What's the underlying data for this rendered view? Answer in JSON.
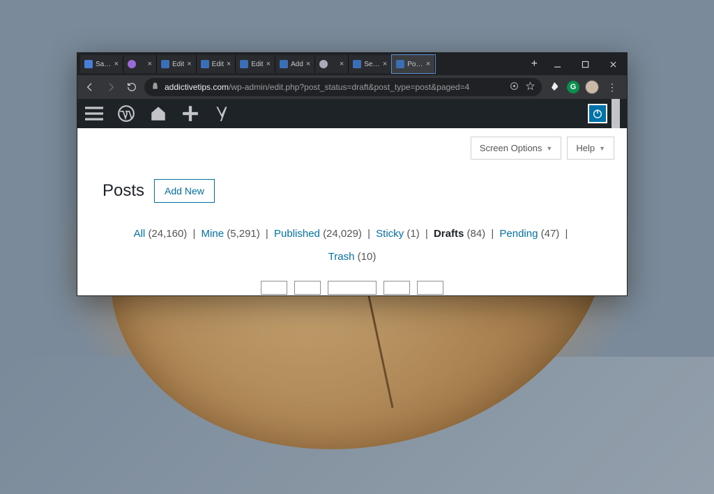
{
  "tabs": [
    {
      "label": "Sage",
      "kind": "s1"
    },
    {
      "label": "",
      "kind": "s2"
    },
    {
      "label": "Edit",
      "kind": "wp"
    },
    {
      "label": "Edit",
      "kind": "wp"
    },
    {
      "label": "Edit",
      "kind": "wp"
    },
    {
      "label": "Add",
      "kind": "wp"
    },
    {
      "label": "",
      "kind": "loading"
    },
    {
      "label": "Searc",
      "kind": "wp"
    },
    {
      "label": "Posts",
      "kind": "wp",
      "active": true
    }
  ],
  "url": {
    "host": "addictivetips.com",
    "path": "/wp-admin/edit.php?post_status=draft&post_type=post&paged=4"
  },
  "topButtons": {
    "screenOptions": "Screen Options",
    "help": "Help"
  },
  "page": {
    "title": "Posts",
    "addNew": "Add New"
  },
  "filters": [
    {
      "label": "All",
      "count": "(24,160)",
      "current": false
    },
    {
      "label": "Mine",
      "count": "(5,291)",
      "current": false
    },
    {
      "label": "Published",
      "count": "(24,029)",
      "current": false
    },
    {
      "label": "Sticky",
      "count": "(1)",
      "current": false
    },
    {
      "label": "Drafts",
      "count": "(84)",
      "current": true
    },
    {
      "label": "Pending",
      "count": "(47)",
      "current": false
    },
    {
      "label": "Trash",
      "count": "(10)",
      "current": false
    }
  ]
}
